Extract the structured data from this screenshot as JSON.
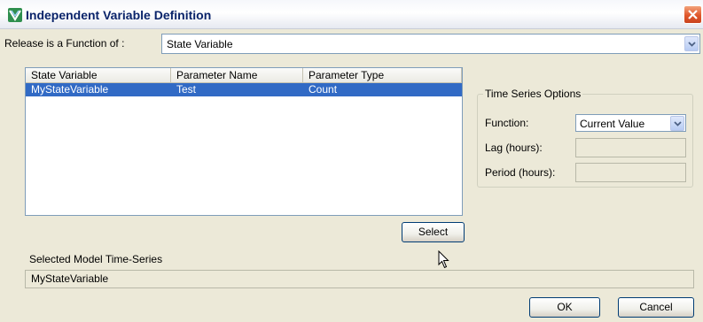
{
  "window": {
    "title": "Independent Variable Definition",
    "accent": "#0a246a",
    "close_color": "#e0562a"
  },
  "release": {
    "label": "Release is a Function of :",
    "selected": "State Variable"
  },
  "table": {
    "columns": [
      "State Variable",
      "Parameter Name",
      "Parameter Type"
    ],
    "rows": [
      {
        "state_variable": "MyStateVariable",
        "parameter_name": "Test",
        "parameter_type": "Count",
        "selected": true
      }
    ],
    "selection_color": "#316ac5"
  },
  "time_series": {
    "title": "Time Series Options",
    "function_label": "Function:",
    "function_value": "Current Value",
    "lag_label": "Lag (hours):",
    "lag_value": "",
    "period_label": "Period (hours):",
    "period_value": ""
  },
  "select_button": "Select",
  "selected_series": {
    "label": "Selected Model Time-Series",
    "value": "MyStateVariable"
  },
  "buttons": {
    "ok": "OK",
    "cancel": "Cancel"
  },
  "icons": {
    "app": "app-icon",
    "close": "close-icon",
    "dropdown": "chevron-down-icon",
    "cursor": "mouse-pointer-icon"
  }
}
